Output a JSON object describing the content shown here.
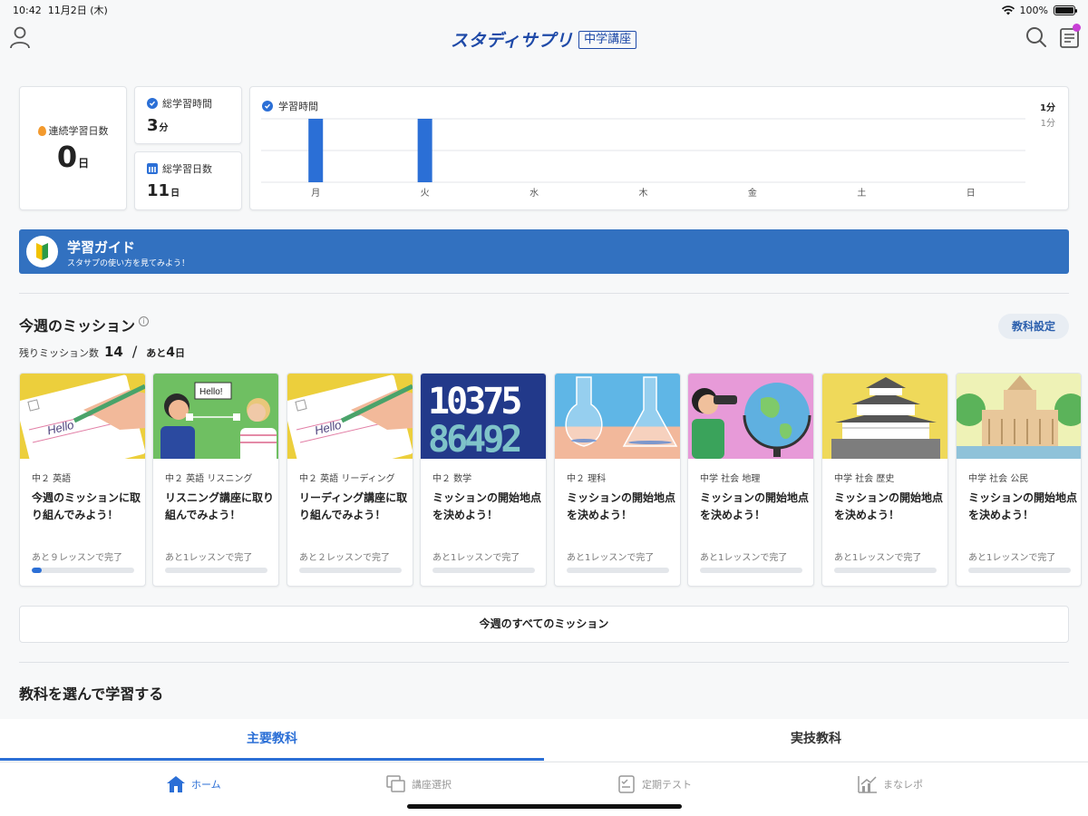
{
  "status_bar": {
    "time": "10:42",
    "date": "11月2日 (木)",
    "battery": "100%"
  },
  "header": {
    "logo_text": "スタディサプリ",
    "logo_badge": "中学講座"
  },
  "stats": {
    "streak_label": "連続学習日数",
    "streak_value": "0",
    "streak_unit": "日",
    "total_time_label": "総学習時間",
    "total_time_value": "3",
    "total_time_unit": "分",
    "total_days_label": "総学習日数",
    "total_days_value": "11",
    "total_days_unit": "日"
  },
  "chart_data": {
    "type": "bar",
    "title": "学習時間",
    "categories": [
      "月",
      "火",
      "水",
      "木",
      "金",
      "土",
      "日"
    ],
    "values": [
      1,
      1,
      0,
      0,
      0,
      0,
      0
    ],
    "ylim": [
      0,
      1
    ],
    "max_label_bold": "1分",
    "max_label": "1分",
    "bar_color": "#2b6fd6",
    "grid": true
  },
  "guide": {
    "title": "学習ガイド",
    "subtitle": "スタサプの使い方を見てみよう！"
  },
  "missions": {
    "title": "今週のミッション",
    "settings_label": "教科設定",
    "remaining_label": "残りミッション数",
    "remaining_count": "14",
    "days_prefix": "あと",
    "days_value": "4",
    "days_unit": "日",
    "items": [
      {
        "subject": "中２ 英語",
        "text": "今週のミッションに取り組んでみよう！",
        "remain": "あと９レッスンで完了",
        "progress": 0.1
      },
      {
        "subject": "中２ 英語 リスニング",
        "text": "リスニング講座に取り組んでみよう！",
        "remain": "あと1レッスンで完了",
        "progress": 0
      },
      {
        "subject": "中２ 英語 リーディング",
        "text": "リーディング講座に取り組んでみよう！",
        "remain": "あと２レッスンで完了",
        "progress": 0
      },
      {
        "subject": "中２ 数学",
        "text": "ミッションの開始地点を決めよう！",
        "remain": "あと1レッスンで完了",
        "progress": 0
      },
      {
        "subject": "中２ 理科",
        "text": "ミッションの開始地点を決めよう！",
        "remain": "あと1レッスンで完了",
        "progress": 0
      },
      {
        "subject": "中学 社会 地理",
        "text": "ミッションの開始地点を決めよう！",
        "remain": "あと1レッスンで完了",
        "progress": 0
      },
      {
        "subject": "中学 社会 歴史",
        "text": "ミッションの開始地点を決めよう！",
        "remain": "あと1レッスンで完了",
        "progress": 0
      },
      {
        "subject": "中学 社会 公民",
        "text": "ミッションの開始地点を決めよう！",
        "remain": "あと1レッスンで完了",
        "progress": 0
      }
    ],
    "image_texts": {
      "hello": "Hello",
      "hello_bubble": "Hello!",
      "digits": "1037586492"
    },
    "all_button": "今週のすべてのミッション"
  },
  "subjects": {
    "title": "教科を選んで学習する",
    "tab_main": "主要教科",
    "tab_skill": "実技教科"
  },
  "bottom_nav": {
    "home": "ホーム",
    "course": "講座選択",
    "test": "定期テスト",
    "report": "まなレポ"
  }
}
